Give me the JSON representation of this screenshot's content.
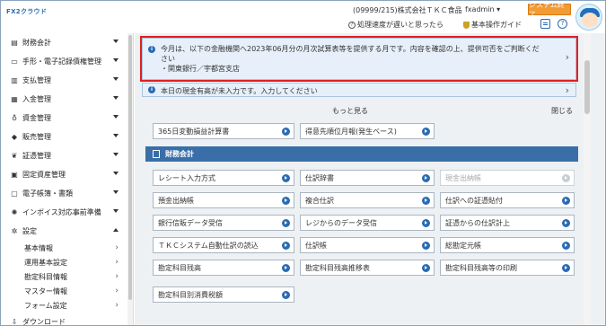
{
  "header": {
    "logo_text": "FX2クラウド",
    "company": "(09999/215)株式会社ＴＫＣ食品",
    "user": "fxadmin ▾",
    "exit_label": "システム終了",
    "link_slow": "処理速度が遅いと思ったら",
    "link_guide": "基本操作ガイド"
  },
  "sidebar": {
    "items": [
      {
        "label": "財務会計",
        "icon": "ledger-icon"
      },
      {
        "label": "手形・電子記録債権管理",
        "icon": "bill-icon"
      },
      {
        "label": "支払管理",
        "icon": "payment-icon"
      },
      {
        "label": "入金管理",
        "icon": "receipt-icon"
      },
      {
        "label": "資金管理",
        "icon": "money-bag-icon"
      },
      {
        "label": "販売管理",
        "icon": "tag-icon"
      },
      {
        "label": "証憑管理",
        "icon": "document-icon"
      },
      {
        "label": "固定資産管理",
        "icon": "building-icon"
      },
      {
        "label": "電子帳簿・書類",
        "icon": "book-icon"
      },
      {
        "label": "インボイス対応事前準備",
        "icon": "lightbulb-icon"
      },
      {
        "label": "設定",
        "icon": "gear-icon"
      }
    ],
    "sub_items": [
      "基本情報",
      "運用基本設定",
      "勘定科目情報",
      "マスター情報",
      "フォーム設定"
    ],
    "partial_item": "ダウンロード"
  },
  "notices": {
    "first_line1": "今月は、以下の金融機関へ2023年06月分の月次試算表等を提供する月です。内容を確認の上、提供可否をご判断くだ",
    "first_line2": "さい",
    "first_line3": "・関東銀行／宇都宮支店",
    "second": "本日の現金有高が未入力です。入力してください"
  },
  "more_label": "もっと見る",
  "close_label": "閉じる",
  "top_buttons": [
    "365日変動損益計算書",
    "得意先順位月報(発生ベース)"
  ],
  "section_title": "財務会計",
  "grid_buttons": [
    [
      "レシート入力方式",
      "仕訳辞書",
      "現金出納帳"
    ],
    [
      "預金出納帳",
      "複合仕訳",
      "仕訳への証憑貼付"
    ],
    [
      "銀行信販データ受信",
      "レジからのデータ受信",
      "証憑からの仕訳計上"
    ],
    [
      "ＴＫＣシステム自動仕訳の読込",
      "仕訳帳",
      "総勘定元帳"
    ],
    [
      "勘定科目残高",
      "勘定科目残高推移表",
      "勘定科目残高等の印刷"
    ],
    [
      "勘定科目別消費税額"
    ]
  ]
}
